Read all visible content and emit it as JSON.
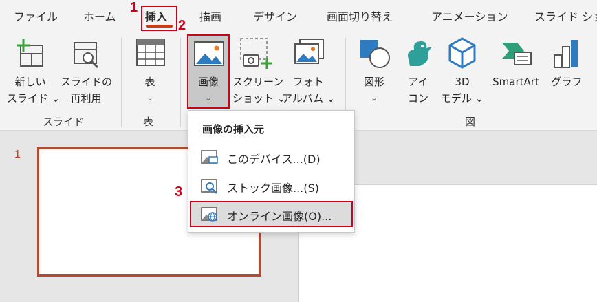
{
  "tabs": [
    {
      "label": "ファイル"
    },
    {
      "label": "ホーム"
    },
    {
      "label": "挿入"
    },
    {
      "label": "描画"
    },
    {
      "label": "デザイン"
    },
    {
      "label": "画面切り替え"
    },
    {
      "label": "アニメーション"
    },
    {
      "label": "スライド ショ"
    }
  ],
  "steps": [
    "1",
    "2",
    "3"
  ],
  "ribbon": {
    "new_slide": {
      "line1": "新しい",
      "line2": "スライド ⌄"
    },
    "reuse_slide": {
      "line1": "スライドの",
      "line2": "再利用"
    },
    "table": {
      "line1": "表",
      "line2": "⌄"
    },
    "picture": {
      "line1": "画像",
      "line2": "⌄"
    },
    "screenshot": {
      "line1": "スクリーン",
      "line2": "ショット ⌄"
    },
    "photo_album": {
      "line1": "フォト",
      "line2": "アルバム ⌄"
    },
    "shapes": {
      "line1": "図形",
      "line2": "⌄"
    },
    "icons": {
      "line1": "アイ",
      "line2": "コン"
    },
    "model3d": {
      "line1": "3D",
      "line2": "モデル ⌄"
    },
    "smartart": {
      "line1": "SmartArt"
    },
    "chart": {
      "line1": "グラフ"
    },
    "groups": {
      "slides": "スライド",
      "tables": "表",
      "illustrations": "図"
    }
  },
  "slide": {
    "number": "1"
  },
  "dropdown": {
    "header": "画像の挿入元",
    "items": [
      {
        "label": "このデバイス...(D)"
      },
      {
        "label": "ストック画像...(S)"
      },
      {
        "label": "オンライン画像(O)..."
      }
    ]
  },
  "colors": {
    "accent": "#c43e1c",
    "highlight": "#d0021b"
  }
}
